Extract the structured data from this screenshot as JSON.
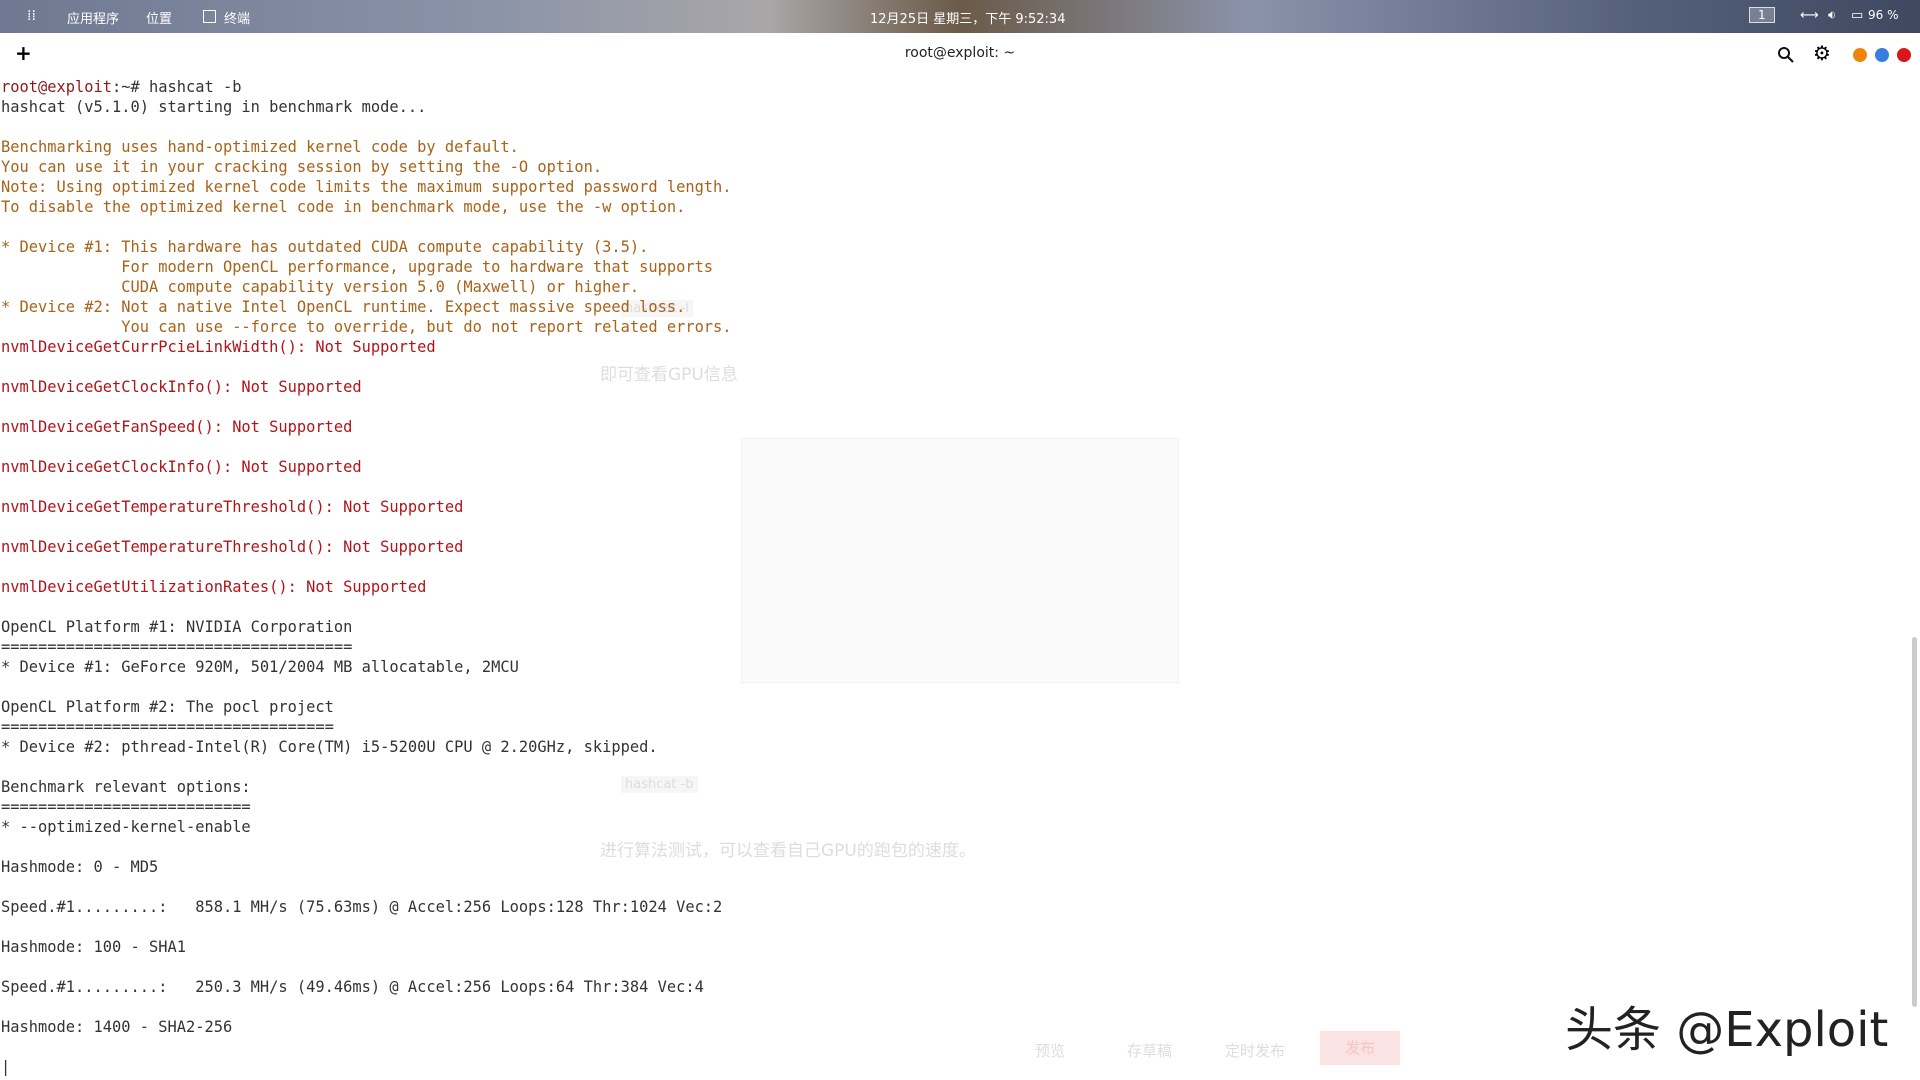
{
  "topbar": {
    "apps": "应用程序",
    "places": "位置",
    "terminal_app": "终端",
    "clock": "12月25日 星期三，下午 9:52:34",
    "workspace": "1",
    "battery": "96 %"
  },
  "window": {
    "title": "root@exploit: ~",
    "new_tab": "+"
  },
  "terminal": {
    "lines": [
      {
        "t": "root@exploit:~# hashcat -b",
        "c": "prompt"
      },
      {
        "t": "hashcat (v5.1.0) starting in benchmark mode...",
        "c": ""
      },
      {
        "t": "",
        "c": ""
      },
      {
        "t": "Benchmarking uses hand-optimized kernel code by default.",
        "c": "warn"
      },
      {
        "t": "You can use it in your cracking session by setting the -O option.",
        "c": "warn"
      },
      {
        "t": "Note: Using optimized kernel code limits the maximum supported password length.",
        "c": "warn"
      },
      {
        "t": "To disable the optimized kernel code in benchmark mode, use the -w option.",
        "c": "warn"
      },
      {
        "t": "",
        "c": ""
      },
      {
        "t": "* Device #1: This hardware has outdated CUDA compute capability (3.5).",
        "c": "warn"
      },
      {
        "t": "             For modern OpenCL performance, upgrade to hardware that supports",
        "c": "warn"
      },
      {
        "t": "             CUDA compute capability version 5.0 (Maxwell) or higher.",
        "c": "warn"
      },
      {
        "t": "* Device #2: Not a native Intel OpenCL runtime. Expect massive speed loss.",
        "c": "warn"
      },
      {
        "t": "             You can use --force to override, but do not report related errors.",
        "c": "warn"
      },
      {
        "t": "nvmlDeviceGetCurrPcieLinkWidth(): Not Supported",
        "c": "err"
      },
      {
        "t": "",
        "c": ""
      },
      {
        "t": "nvmlDeviceGetClockInfo(): Not Supported",
        "c": "err"
      },
      {
        "t": "",
        "c": ""
      },
      {
        "t": "nvmlDeviceGetFanSpeed(): Not Supported",
        "c": "err"
      },
      {
        "t": "",
        "c": ""
      },
      {
        "t": "nvmlDeviceGetClockInfo(): Not Supported",
        "c": "err"
      },
      {
        "t": "",
        "c": ""
      },
      {
        "t": "nvmlDeviceGetTemperatureThreshold(): Not Supported",
        "c": "err"
      },
      {
        "t": "",
        "c": ""
      },
      {
        "t": "nvmlDeviceGetTemperatureThreshold(): Not Supported",
        "c": "err"
      },
      {
        "t": "",
        "c": ""
      },
      {
        "t": "nvmlDeviceGetUtilizationRates(): Not Supported",
        "c": "err"
      },
      {
        "t": "",
        "c": ""
      },
      {
        "t": "OpenCL Platform #1: NVIDIA Corporation",
        "c": ""
      },
      {
        "t": "======================================",
        "c": ""
      },
      {
        "t": "* Device #1: GeForce 920M, 501/2004 MB allocatable, 2MCU",
        "c": ""
      },
      {
        "t": "",
        "c": ""
      },
      {
        "t": "OpenCL Platform #2: The pocl project",
        "c": ""
      },
      {
        "t": "====================================",
        "c": ""
      },
      {
        "t": "* Device #2: pthread-Intel(R) Core(TM) i5-5200U CPU @ 2.20GHz, skipped.",
        "c": ""
      },
      {
        "t": "",
        "c": ""
      },
      {
        "t": "Benchmark relevant options:",
        "c": ""
      },
      {
        "t": "===========================",
        "c": ""
      },
      {
        "t": "* --optimized-kernel-enable",
        "c": ""
      },
      {
        "t": "",
        "c": ""
      },
      {
        "t": "Hashmode: 0 - MD5",
        "c": ""
      },
      {
        "t": "",
        "c": ""
      },
      {
        "t": "Speed.#1.........:   858.1 MH/s (75.63ms) @ Accel:256 Loops:128 Thr:1024 Vec:2",
        "c": ""
      },
      {
        "t": "",
        "c": ""
      },
      {
        "t": "Hashmode: 100 - SHA1",
        "c": ""
      },
      {
        "t": "",
        "c": ""
      },
      {
        "t": "Speed.#1.........:   250.3 MH/s (49.46ms) @ Accel:256 Loops:64 Thr:384 Vec:4",
        "c": ""
      },
      {
        "t": "",
        "c": ""
      },
      {
        "t": "Hashmode: 1400 - SHA2-256",
        "c": ""
      },
      {
        "t": "",
        "c": ""
      },
      {
        "t": "|",
        "c": "cursor"
      }
    ]
  },
  "background_page": {
    "h1": "即可查看GPU信息",
    "h2": "进行算法测试，可以查看自己GPU的跑包的速度。",
    "code1": "hashcat -I",
    "code2": "hashcat -b",
    "preview": "预览",
    "draft": "存草稿",
    "schedule": "定时发布",
    "publish": "发布"
  },
  "watermark": "头条 @Exploit",
  "colors": {
    "warning": "#a8631a",
    "error": "#b0141a",
    "dot_orange": "#f0840c",
    "dot_blue": "#3a7de0",
    "dot_red": "#d8161b"
  }
}
